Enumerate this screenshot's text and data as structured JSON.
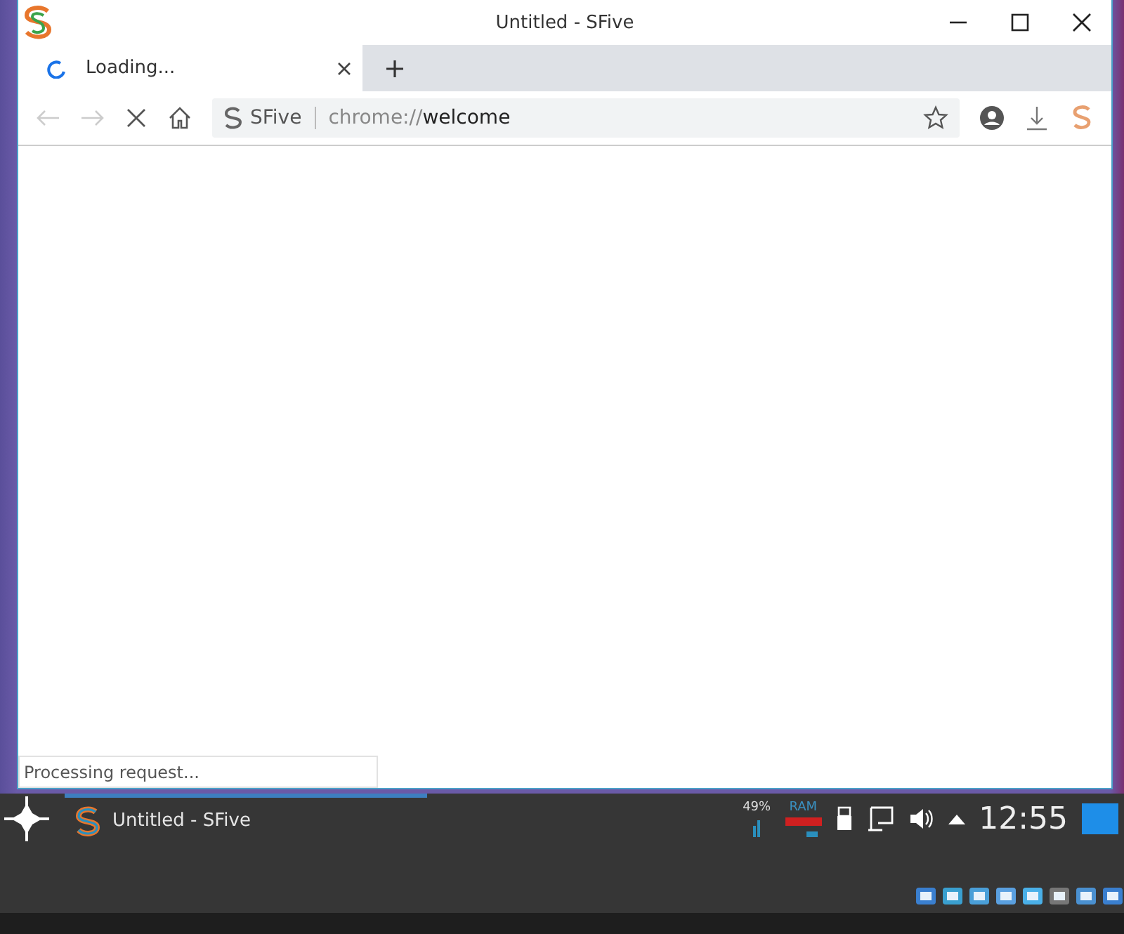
{
  "window": {
    "title": "Untitled - SFive"
  },
  "tabs": [
    {
      "label": "Loading...",
      "loading": true,
      "selected": true
    }
  ],
  "address": {
    "site_name": "SFive",
    "url_scheme": "chrome://",
    "url_rest": "welcome"
  },
  "status_bubble": "Processing request...",
  "taskbar": {
    "tasks": [
      {
        "title": "Untitled - SFive",
        "loading": true
      }
    ],
    "tray": {
      "cpu": "49%",
      "ram_label": "RAM",
      "clock": "12:55"
    }
  }
}
